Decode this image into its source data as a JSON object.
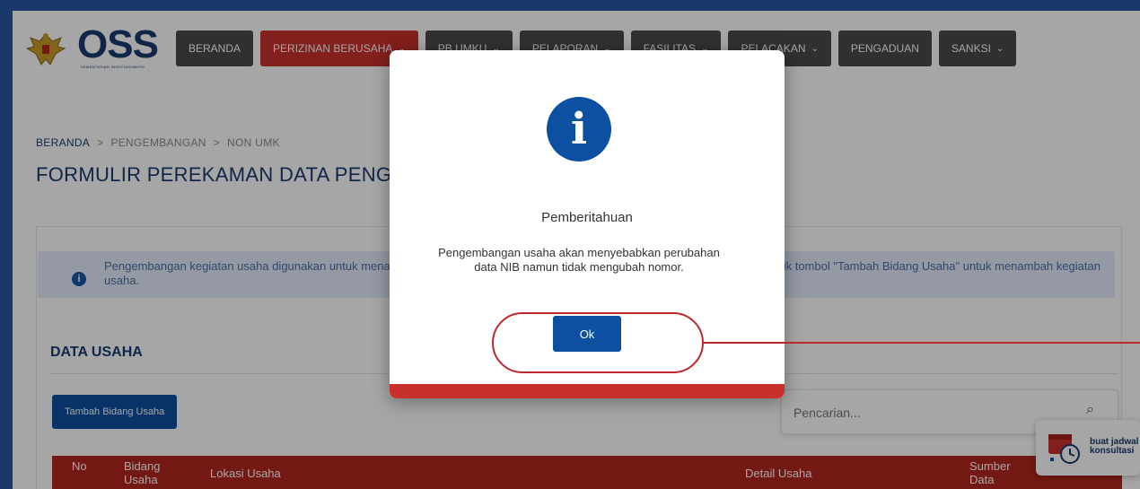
{
  "header": {
    "logo_text": "OSS",
    "logo_subtext": "KEMENTERIAN INVESTASI/BKPM",
    "nav": [
      {
        "label": "BERANDA",
        "has_chevron": false,
        "active": false
      },
      {
        "label": "PERIZINAN BERUSAHA",
        "has_chevron": true,
        "active": true
      },
      {
        "label": "PB UMKU",
        "has_chevron": true,
        "active": false
      },
      {
        "label": "PELAPORAN",
        "has_chevron": true,
        "active": false
      },
      {
        "label": "FASILITAS",
        "has_chevron": true,
        "active": false
      },
      {
        "label": "PELACAKAN",
        "has_chevron": true,
        "active": false
      },
      {
        "label": "PENGADUAN",
        "has_chevron": false,
        "active": false
      },
      {
        "label": "SANKSI",
        "has_chevron": true,
        "active": false
      }
    ]
  },
  "breadcrumb": {
    "items": [
      "BERANDA",
      "PENGEMBANGAN",
      "NON UMK"
    ],
    "separator": ">"
  },
  "page": {
    "title": "FORMULIR PEREKAMAN DATA PENGEMBANGAN (BIDANG USAHA) NON UMK"
  },
  "alert": {
    "text": "Pengembangan kegiatan usaha digunakan untuk menambah bidang usaha, produk/jasa, dan/atau lokasi kegiatan usaha. Silakan klik tombol \"Tambah Bidang Usaha\" untuk menambah kegiatan usaha."
  },
  "section": {
    "title": "DATA USAHA",
    "add_button": "Tambah Bidang Usaha",
    "search_placeholder": "Pencarian..."
  },
  "table": {
    "columns": [
      "No",
      "Bidang Usaha",
      "Lokasi Usaha",
      "Detail Usaha",
      "Sumber Data"
    ]
  },
  "chat_widget": {
    "line1": "buat jadwal",
    "line2": "konsultasi"
  },
  "modal": {
    "title": "Pemberitahuan",
    "message": "Pengembangan usaha akan menyebabkan perubahan data NIB namun tidak mengubah nomor.",
    "ok_label": "Ok"
  },
  "colors": {
    "frame_border": "#1a3769",
    "primary": "#0d4fa0",
    "accent_red": "#c9302c",
    "nav_dark": "#4a4a4a"
  }
}
